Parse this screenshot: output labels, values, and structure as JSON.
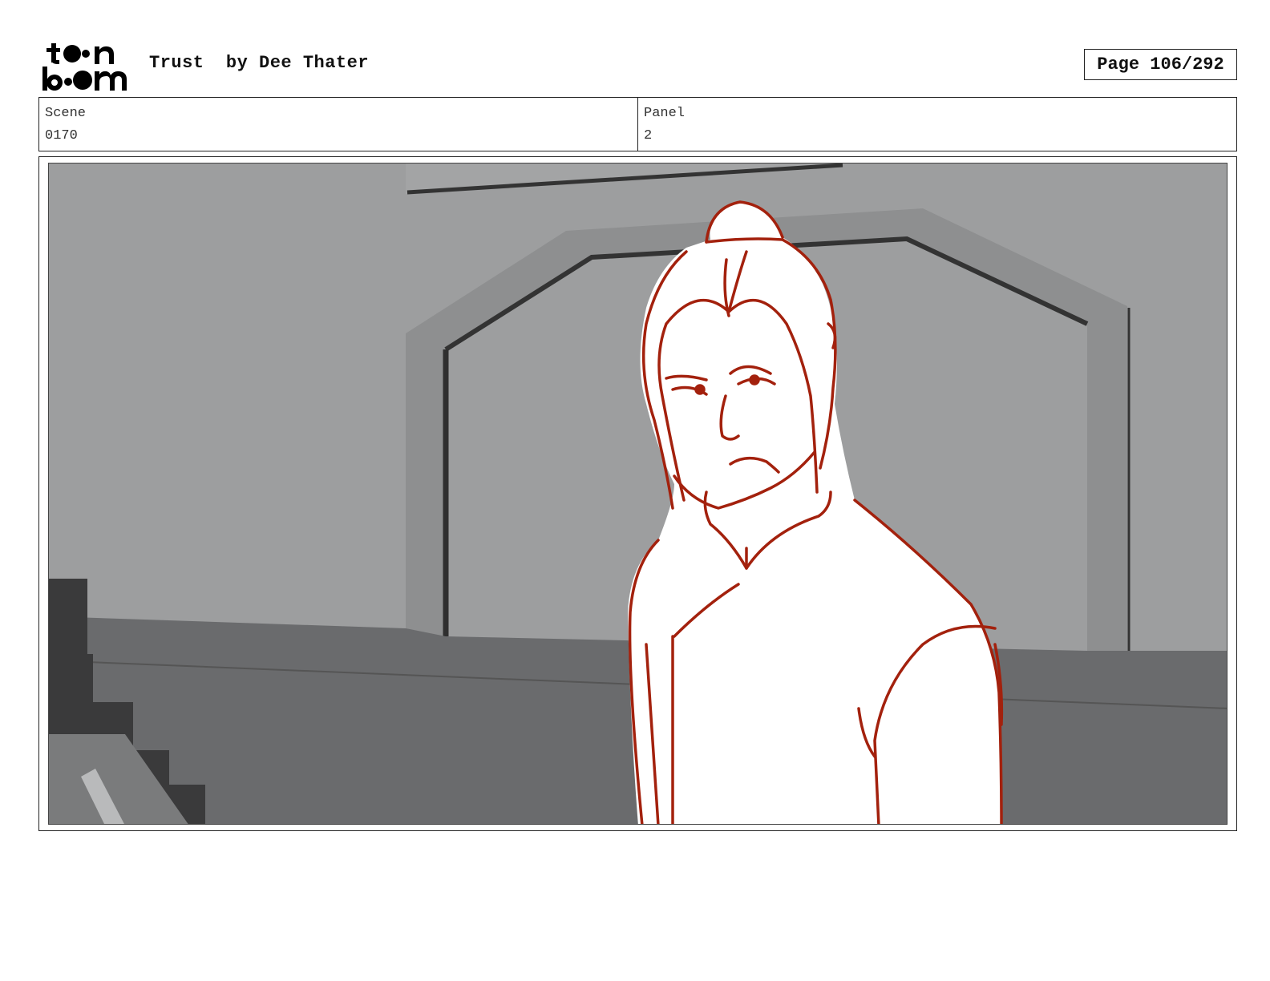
{
  "header": {
    "logo_text": "toon boom",
    "title": "Trust  by Dee Thater",
    "page_label": "Page 106/292"
  },
  "info": {
    "scene_label": "Scene",
    "scene_value": "0170",
    "panel_label": "Panel",
    "panel_value": "2"
  },
  "colors": {
    "sketch_line": "#a3210d",
    "wall": "#9c9d9e",
    "floor": "#68696b"
  }
}
